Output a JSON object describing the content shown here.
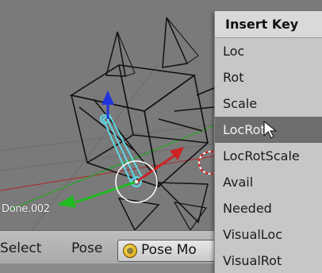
{
  "viewport": {
    "object_label": "Done.002"
  },
  "header": {
    "items": [
      "Select",
      "Pose"
    ],
    "mode_label": "Pose Mo"
  },
  "insert_key_menu": {
    "title": "Insert Key",
    "items": [
      "Loc",
      "Rot",
      "Scale",
      "LocRot",
      "LocRotScale",
      "Avail",
      "Needed",
      "VisualLoc",
      "VisualRot"
    ],
    "highlighted": "LocRot"
  },
  "colors": {
    "viewport_bg": "#7a7a7a",
    "bone_selected": "#5fd9e6",
    "axis_x": "#cc2222",
    "axis_y": "#22bb22",
    "axis_z": "#2233dd",
    "menu_bg": "#c7c7c7",
    "menu_highlight": "#6e6e6e"
  }
}
